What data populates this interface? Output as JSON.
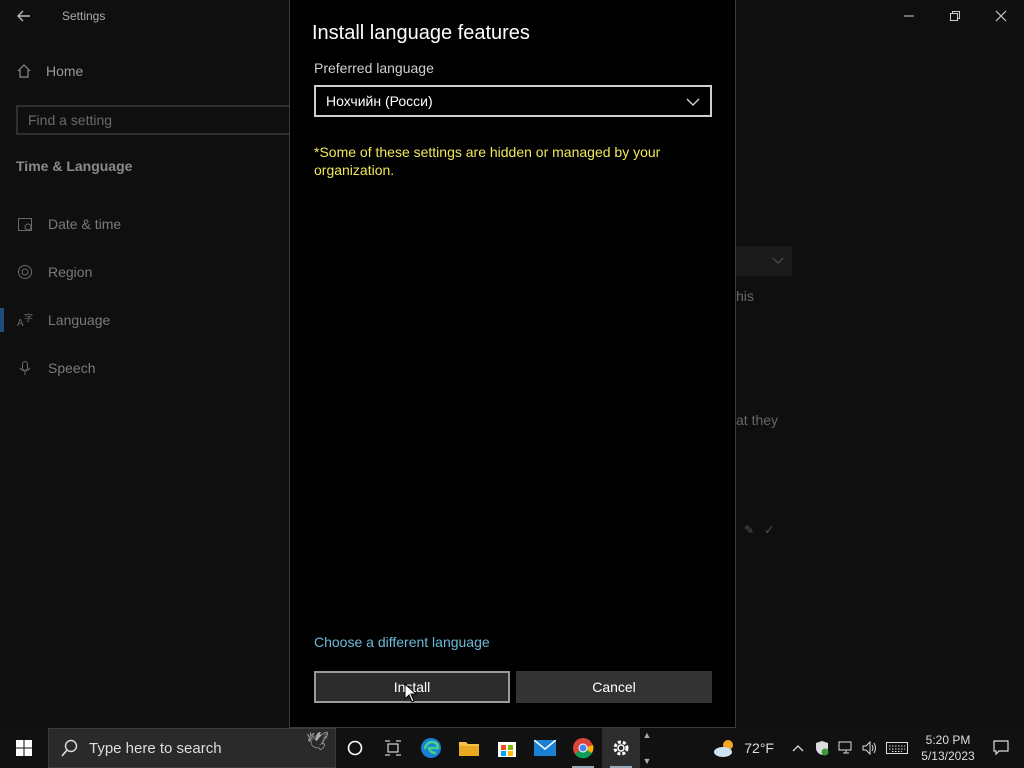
{
  "settings": {
    "app_title": "Settings",
    "home_label": "Home",
    "search_placeholder": "Find a setting",
    "section_title": "Time & Language",
    "nav": [
      {
        "label": "Date & time",
        "icon": "calendar-icon"
      },
      {
        "label": "Region",
        "icon": "globe-icon"
      },
      {
        "label": "Language",
        "icon": "language-icon"
      },
      {
        "label": "Speech",
        "icon": "microphone-icon"
      }
    ],
    "bg_text_1": "his",
    "bg_text_2": "at they"
  },
  "dialog": {
    "title": "Install language features",
    "preferred_label": "Preferred language",
    "selected_language": "Нохчийн (Росси)",
    "notice": "*Some of these settings are hidden or managed by your organization.",
    "different_language_link": "Choose a different language",
    "install_label": "Install",
    "cancel_label": "Cancel"
  },
  "taskbar": {
    "search_placeholder": "Type here to search",
    "temperature": "72°F",
    "time": "5:20 PM",
    "date": "5/13/2023"
  },
  "colors": {
    "notice": "#f1e85a",
    "link": "#6fb9d8",
    "accent": "#1f4d7a"
  }
}
